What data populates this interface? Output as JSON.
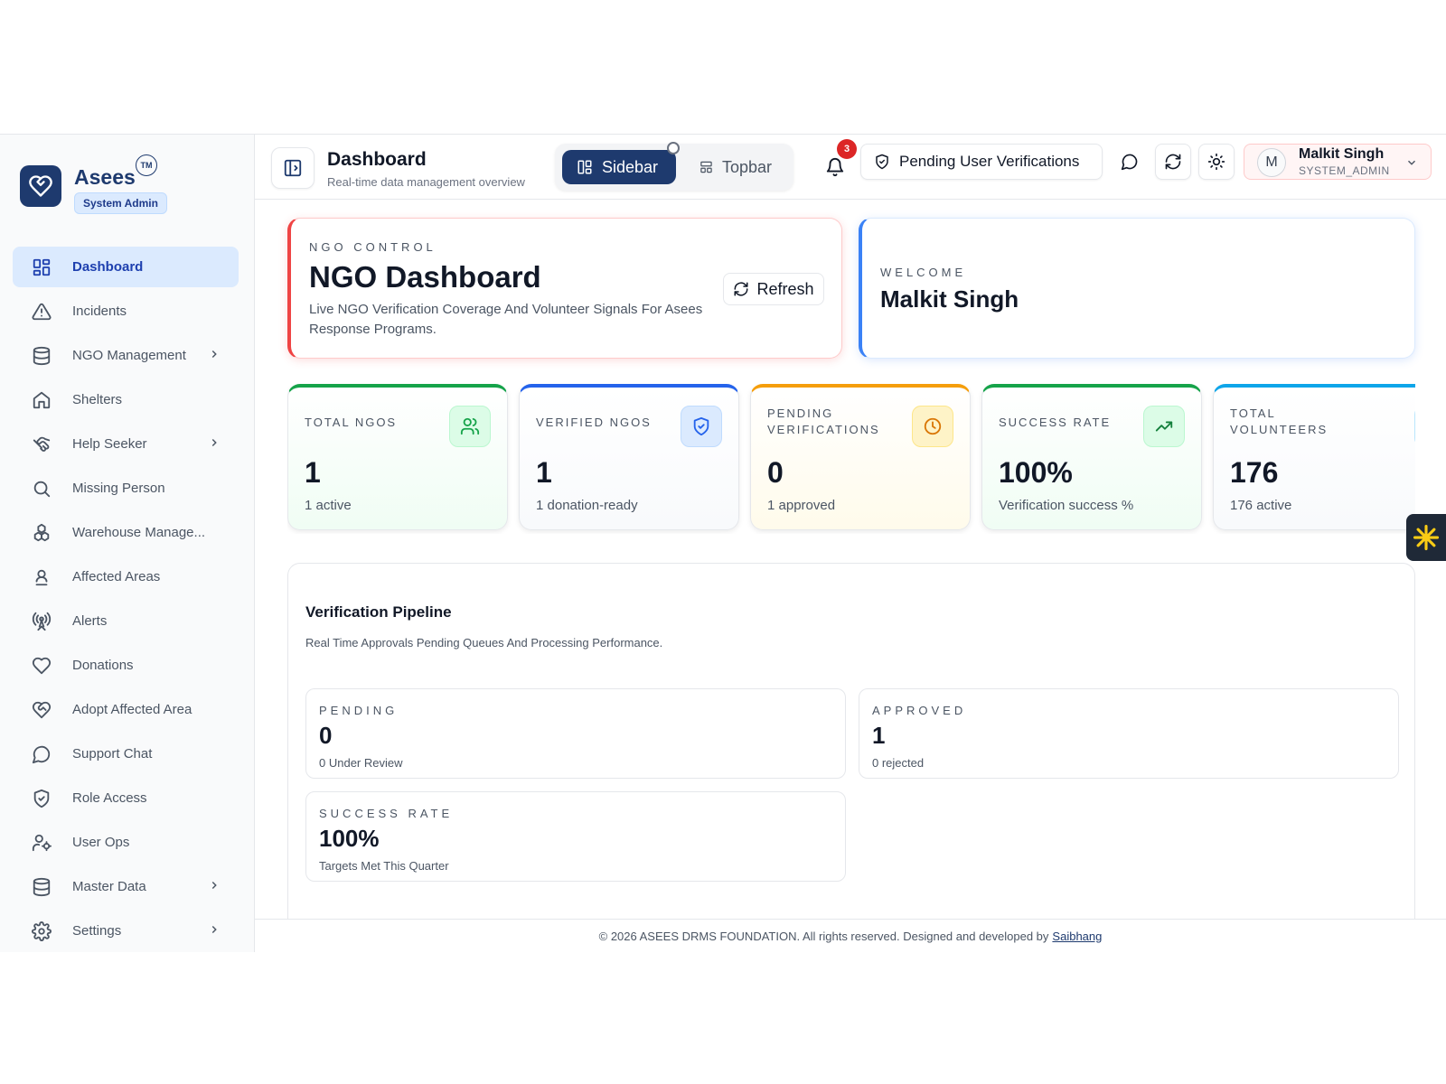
{
  "brand": {
    "name": "Asees",
    "tm": "TM",
    "role": "System Admin"
  },
  "sidebar": {
    "items": [
      {
        "label": "Dashboard",
        "icon": "dashboard-grid-icon",
        "active": true,
        "chevron": false
      },
      {
        "label": "Incidents",
        "icon": "warning-triangle-icon",
        "chevron": false
      },
      {
        "label": "NGO Management",
        "icon": "database-icon",
        "chevron": true
      },
      {
        "label": "Shelters",
        "icon": "home-icon",
        "chevron": false
      },
      {
        "label": "Help Seeker",
        "icon": "handshake-icon",
        "chevron": true
      },
      {
        "label": "Missing Person",
        "icon": "search-icon",
        "chevron": false
      },
      {
        "label": "Warehouse Manage...",
        "icon": "boxes-icon",
        "chevron": false
      },
      {
        "label": "Affected Areas",
        "icon": "map-pin-user-icon",
        "chevron": false
      },
      {
        "label": "Alerts",
        "icon": "radio-tower-icon",
        "chevron": false
      },
      {
        "label": "Donations",
        "icon": "heart-icon",
        "chevron": false
      },
      {
        "label": "Adopt Affected Area",
        "icon": "heart-handshake-icon",
        "chevron": false
      },
      {
        "label": "Support Chat",
        "icon": "chat-bubble-icon",
        "chevron": false
      },
      {
        "label": "Role Access",
        "icon": "shield-check-icon",
        "chevron": false
      },
      {
        "label": "User Ops",
        "icon": "user-cog-icon",
        "chevron": false
      },
      {
        "label": "Master Data",
        "icon": "database-icon",
        "chevron": true
      },
      {
        "label": "Settings",
        "icon": "gear-icon",
        "chevron": true
      }
    ]
  },
  "header": {
    "title": "Dashboard",
    "subtitle": "Real-time data management overview",
    "layout_sidebar": "Sidebar",
    "layout_topbar": "Topbar",
    "notification_count": "3",
    "pending_label": "Pending User Verifications",
    "user": {
      "initial": "M",
      "name": "Malkit Singh",
      "role": "SYSTEM_ADMIN"
    }
  },
  "hero": {
    "overline": "NGO CONTROL",
    "title": "NGO Dashboard",
    "description": "Live NGO Verification Coverage And Volunteer Signals For Asees Response Programs.",
    "refresh_label": "Refresh"
  },
  "welcome": {
    "overline": "WELCOME",
    "name": "Malkit Singh"
  },
  "stats": [
    {
      "label": "TOTAL NGOS",
      "value": "1",
      "sub": "1 active",
      "color": "#16a34a",
      "icon": "users-icon"
    },
    {
      "label": "VERIFIED NGOS",
      "value": "1",
      "sub": "1 donation-ready",
      "color": "#2563eb",
      "icon": "shield-check-icon"
    },
    {
      "label": "PENDING VERIFICATIONS",
      "value": "0",
      "sub": "1 approved",
      "color": "#f59e0b",
      "icon": "clock-icon"
    },
    {
      "label": "SUCCESS RATE",
      "value": "100%",
      "sub": "Verification success %",
      "color": "#16a34a",
      "icon": "trending-up-icon"
    },
    {
      "label": "TOTAL VOLUNTEERS",
      "value": "176",
      "sub": "176 active",
      "color": "#0ea5e9",
      "icon": "users-icon"
    }
  ],
  "pipeline": {
    "title": "Verification Pipeline",
    "subtitle": "Real Time Approvals Pending Queues And Processing Performance.",
    "boxes": [
      {
        "label": "PENDING",
        "value": "0",
        "sub": "0 Under Review"
      },
      {
        "label": "APPROVED",
        "value": "1",
        "sub": "0 rejected"
      },
      {
        "label": "SUCCESS RATE",
        "value": "100%",
        "sub": "Targets Met This Quarter"
      }
    ]
  },
  "footer": {
    "text": "© 2026 ASEES DRMS FOUNDATION. All rights reserved. Designed and developed by",
    "link": "Saibhang"
  }
}
